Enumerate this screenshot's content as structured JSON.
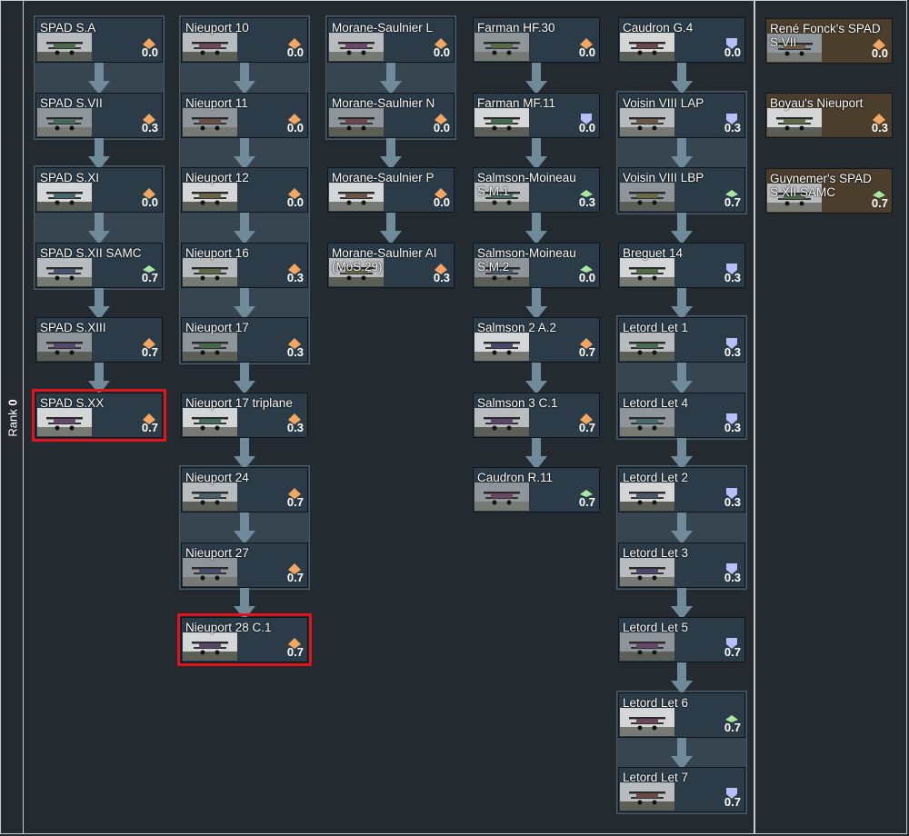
{
  "rank_label": {
    "text": "Rank",
    "number": "0"
  },
  "icon_colors": {
    "fighter": "#f4a560",
    "bomber": "#b6bff7",
    "attacker": "#a8e6a0"
  },
  "vehicles": [
    {
      "id": "spad-sa",
      "name": "SPAD S.A",
      "rating": "0.0",
      "role": "fighter",
      "premium": false,
      "highlight": false,
      "icon": "fighter-icon"
    },
    {
      "id": "spad-svii",
      "name": "SPAD S.VII",
      "rating": "0.3",
      "role": "fighter",
      "premium": false,
      "highlight": false,
      "icon": "fighter-icon"
    },
    {
      "id": "spad-sxi",
      "name": "SPAD S.XI",
      "rating": "0.0",
      "role": "fighter",
      "premium": false,
      "highlight": false,
      "icon": "fighter-icon"
    },
    {
      "id": "spad-sxii",
      "name": "SPAD S.XII SAMC",
      "rating": "0.7",
      "role": "attacker",
      "premium": false,
      "highlight": false,
      "icon": "attacker-icon"
    },
    {
      "id": "spad-sxiii",
      "name": "SPAD S.XIII",
      "rating": "0.7",
      "role": "fighter",
      "premium": false,
      "highlight": false,
      "icon": "fighter-icon"
    },
    {
      "id": "spad-sxx",
      "name": "SPAD S.XX",
      "rating": "0.7",
      "role": "fighter",
      "premium": false,
      "highlight": true,
      "icon": "fighter-icon"
    },
    {
      "id": "nieuport-10",
      "name": "Nieuport 10",
      "rating": "0.0",
      "role": "fighter",
      "premium": false,
      "highlight": false,
      "icon": "fighter-icon"
    },
    {
      "id": "nieuport-11",
      "name": "Nieuport 11",
      "rating": "0.0",
      "role": "fighter",
      "premium": false,
      "highlight": false,
      "icon": "fighter-icon"
    },
    {
      "id": "nieuport-12",
      "name": "Nieuport 12",
      "rating": "0.0",
      "role": "fighter",
      "premium": false,
      "highlight": false,
      "icon": "fighter-icon"
    },
    {
      "id": "nieuport-16",
      "name": "Nieuport 16",
      "rating": "0.3",
      "role": "fighter",
      "premium": false,
      "highlight": false,
      "icon": "fighter-icon"
    },
    {
      "id": "nieuport-17",
      "name": "Nieuport 17",
      "rating": "0.3",
      "role": "fighter",
      "premium": false,
      "highlight": false,
      "icon": "fighter-icon"
    },
    {
      "id": "nieuport-17-triplane",
      "name": "Nieuport 17 triplane",
      "rating": "0.3",
      "role": "fighter",
      "premium": false,
      "highlight": false,
      "icon": "fighter-icon"
    },
    {
      "id": "nieuport-24",
      "name": "Nieuport 24",
      "rating": "0.7",
      "role": "fighter",
      "premium": false,
      "highlight": false,
      "icon": "fighter-icon"
    },
    {
      "id": "nieuport-27",
      "name": "Nieuport 27",
      "rating": "0.7",
      "role": "fighter",
      "premium": false,
      "highlight": false,
      "icon": "fighter-icon"
    },
    {
      "id": "nieuport-28",
      "name": "Nieuport 28 C.1",
      "rating": "0.7",
      "role": "fighter",
      "premium": false,
      "highlight": true,
      "icon": "fighter-icon"
    },
    {
      "id": "morane-l",
      "name": "Morane-Saulnier L",
      "rating": "0.0",
      "role": "fighter",
      "premium": false,
      "highlight": false,
      "icon": "fighter-icon"
    },
    {
      "id": "morane-n",
      "name": "Morane-Saulnier N",
      "rating": "0.0",
      "role": "fighter",
      "premium": false,
      "highlight": false,
      "icon": "fighter-icon"
    },
    {
      "id": "morane-p",
      "name": "Morane-Saulnier P",
      "rating": "0.0",
      "role": "fighter",
      "premium": false,
      "highlight": false,
      "icon": "fighter-icon"
    },
    {
      "id": "morane-ai",
      "name": "Morane-Saulnier AI (MoS.29)",
      "rating": "0.3",
      "role": "fighter",
      "premium": false,
      "highlight": false,
      "icon": "fighter-icon"
    },
    {
      "id": "farman-hf30",
      "name": "Farman HF.30",
      "rating": "0.0",
      "role": "fighter",
      "premium": false,
      "highlight": false,
      "icon": "fighter-icon"
    },
    {
      "id": "farman-mf11",
      "name": "Farman MF.11",
      "rating": "0.0",
      "role": "bomber",
      "premium": false,
      "highlight": false,
      "icon": "bomber-icon"
    },
    {
      "id": "salmson-sm1",
      "name": "Salmson-Moineau S.M.1",
      "rating": "0.3",
      "role": "attacker",
      "premium": false,
      "highlight": false,
      "icon": "attacker-icon"
    },
    {
      "id": "salmson-sm2",
      "name": "Salmson-Moineau S.M.2",
      "rating": "0.0",
      "role": "attacker",
      "premium": false,
      "highlight": false,
      "icon": "attacker-icon"
    },
    {
      "id": "salmson-2a2",
      "name": "Salmson 2 A.2",
      "rating": "0.7",
      "role": "fighter",
      "premium": false,
      "highlight": false,
      "icon": "fighter-icon"
    },
    {
      "id": "salmson-3c1",
      "name": "Salmson 3 C.1",
      "rating": "0.7",
      "role": "fighter",
      "premium": false,
      "highlight": false,
      "icon": "fighter-icon"
    },
    {
      "id": "caudron-r11",
      "name": "Caudron R.11",
      "rating": "0.7",
      "role": "attacker",
      "premium": false,
      "highlight": false,
      "icon": "attacker-icon"
    },
    {
      "id": "caudron-g4",
      "name": "Caudron G.4",
      "rating": "0.0",
      "role": "bomber",
      "premium": false,
      "highlight": false,
      "icon": "bomber-icon"
    },
    {
      "id": "voisin-lap",
      "name": "Voisin VIII LAP",
      "rating": "0.3",
      "role": "bomber",
      "premium": false,
      "highlight": false,
      "icon": "bomber-icon"
    },
    {
      "id": "voisin-lbp",
      "name": "Voisin VIII LBP",
      "rating": "0.7",
      "role": "attacker",
      "premium": false,
      "highlight": false,
      "icon": "attacker-icon"
    },
    {
      "id": "breguet-14",
      "name": "Breguet 14",
      "rating": "0.3",
      "role": "bomber",
      "premium": false,
      "highlight": false,
      "icon": "bomber-icon"
    },
    {
      "id": "letord-1",
      "name": "Letord Let 1",
      "rating": "0.3",
      "role": "bomber",
      "premium": false,
      "highlight": false,
      "icon": "bomber-icon"
    },
    {
      "id": "letord-4",
      "name": "Letord Let 4",
      "rating": "0.3",
      "role": "bomber",
      "premium": false,
      "highlight": false,
      "icon": "bomber-icon"
    },
    {
      "id": "letord-2",
      "name": "Letord Let 2",
      "rating": "0.3",
      "role": "bomber",
      "premium": false,
      "highlight": false,
      "icon": "bomber-icon"
    },
    {
      "id": "letord-3",
      "name": "Letord Let 3",
      "rating": "0.3",
      "role": "bomber",
      "premium": false,
      "highlight": false,
      "icon": "bomber-icon"
    },
    {
      "id": "letord-5",
      "name": "Letord Let 5",
      "rating": "0.7",
      "role": "bomber",
      "premium": false,
      "highlight": false,
      "icon": "bomber-icon"
    },
    {
      "id": "letord-6",
      "name": "Letord Let 6",
      "rating": "0.7",
      "role": "attacker",
      "premium": false,
      "highlight": false,
      "icon": "attacker-icon"
    },
    {
      "id": "letord-7",
      "name": "Letord Let 7",
      "rating": "0.7",
      "role": "bomber",
      "premium": false,
      "highlight": false,
      "icon": "bomber-icon"
    },
    {
      "id": "fonck-svii",
      "name": "René Fonck's SPAD S.VII",
      "rating": "0.0",
      "role": "fighter",
      "premium": true,
      "highlight": false,
      "icon": "fighter-icon"
    },
    {
      "id": "boyau-nieuport",
      "name": "Boyau's Nieuport",
      "rating": "0.3",
      "role": "fighter",
      "premium": true,
      "highlight": false,
      "icon": "fighter-icon"
    },
    {
      "id": "guynemer-sxii",
      "name": "Guynemer's SPAD S.XII SAMC",
      "rating": "0.7",
      "role": "attacker",
      "premium": true,
      "highlight": false,
      "icon": "attacker-icon"
    }
  ]
}
